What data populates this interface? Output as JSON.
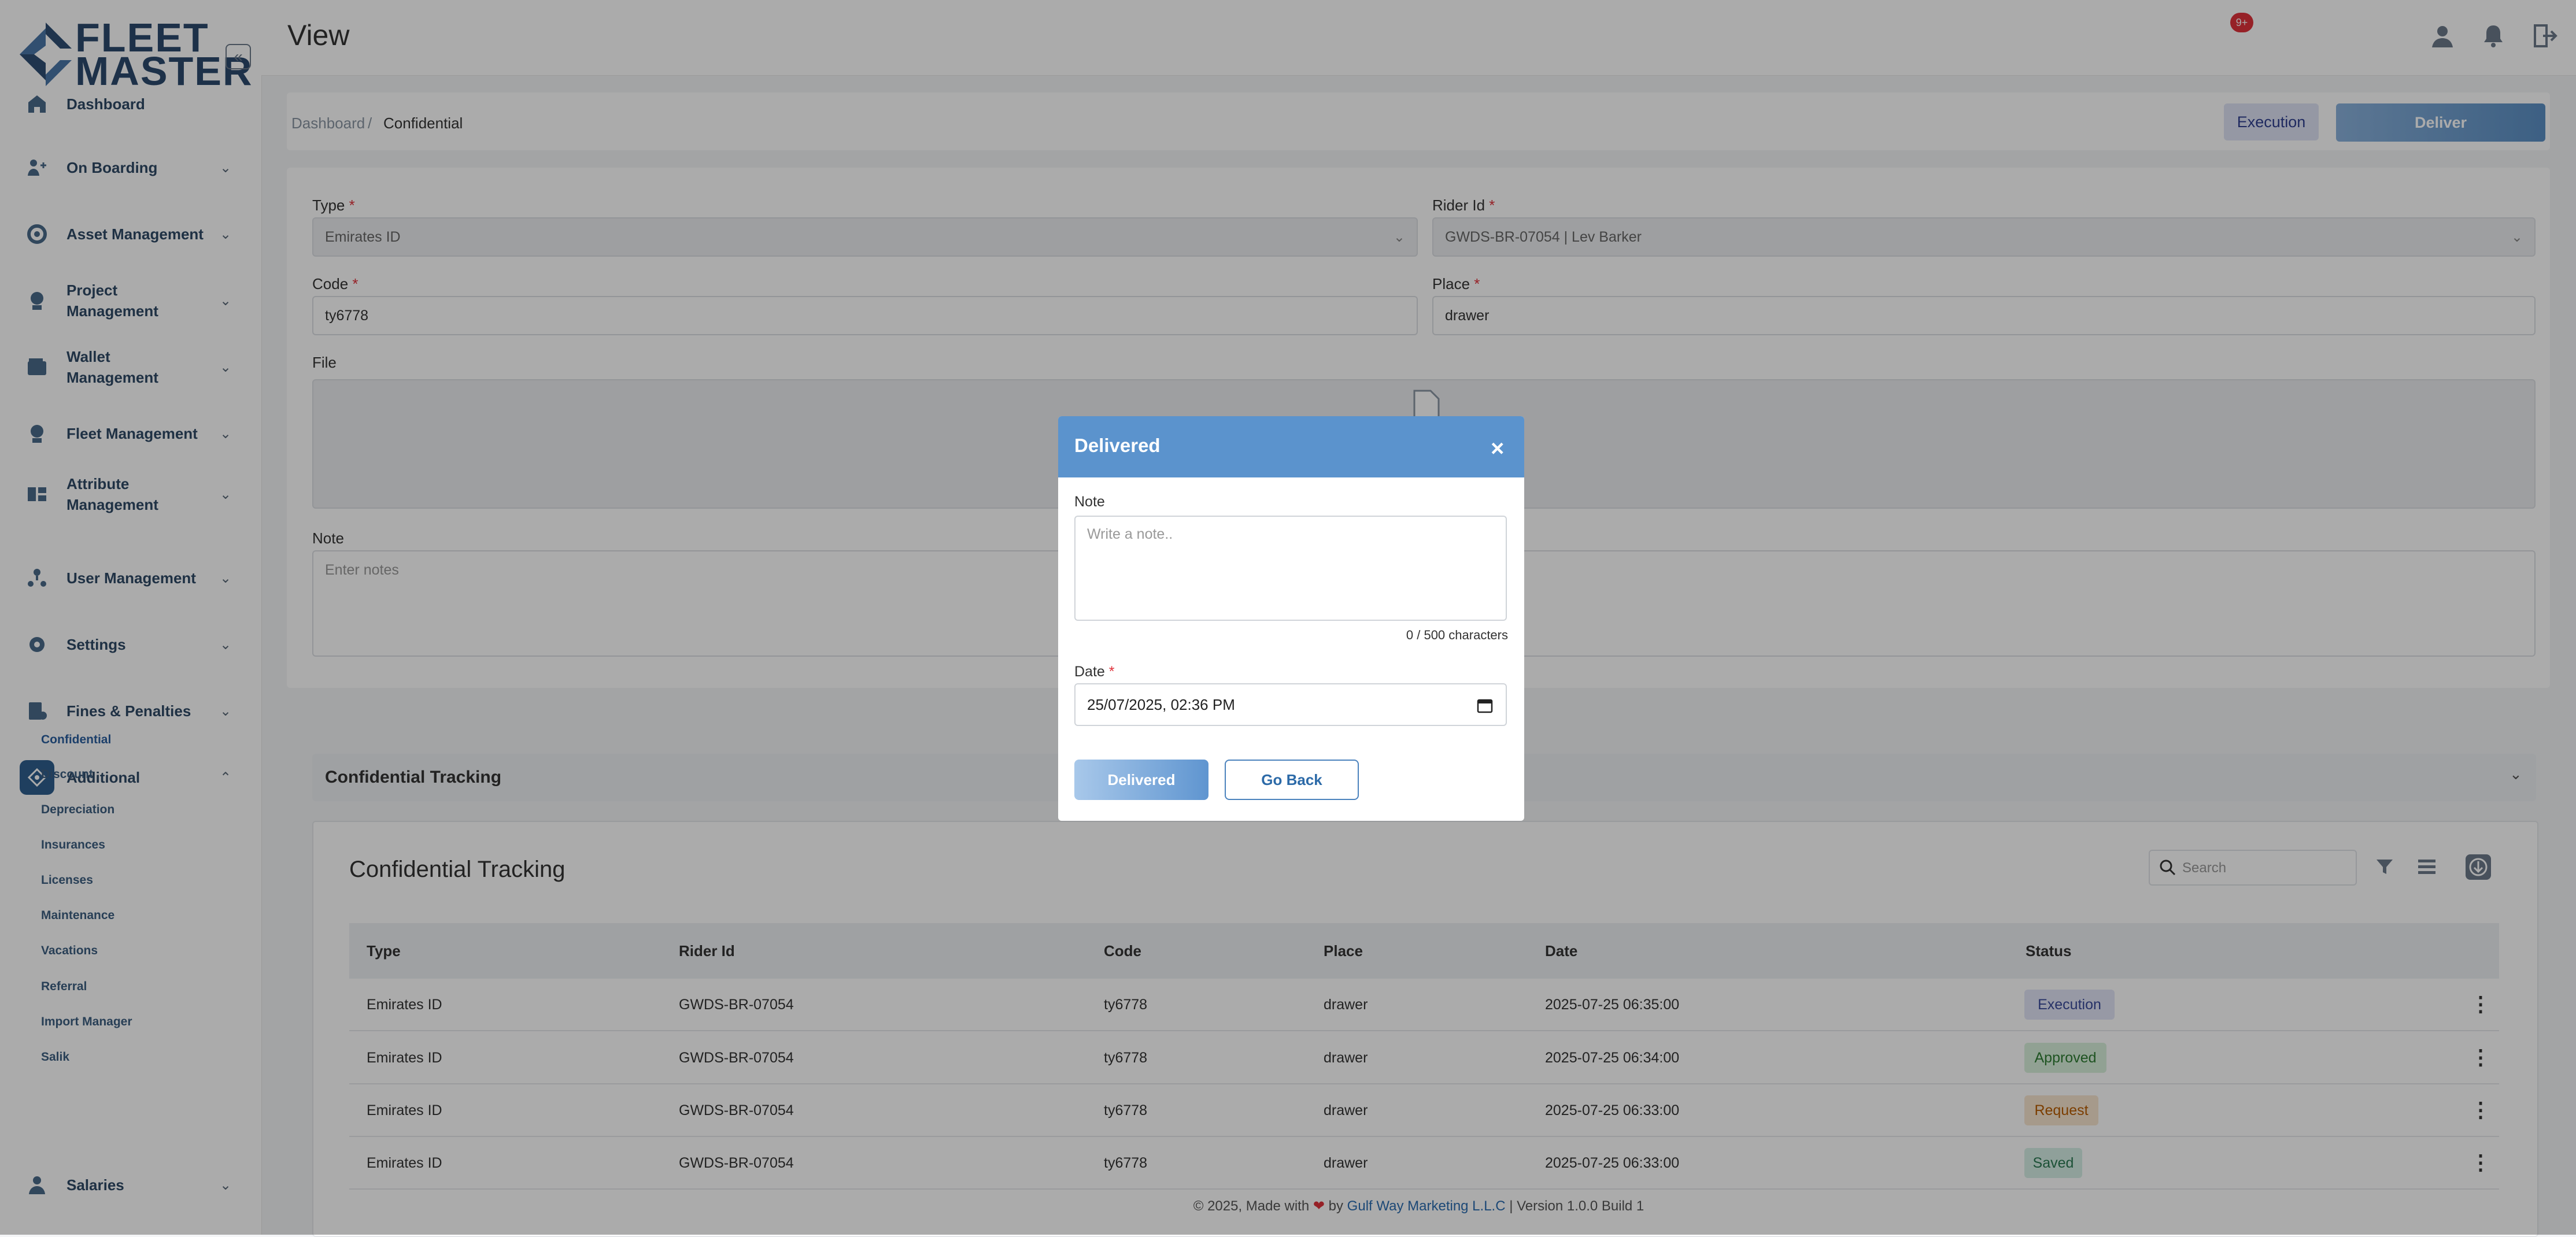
{
  "app": {
    "logo_line1": "FLEET",
    "logo_line2": "MASTER",
    "page_title": "View"
  },
  "sidebar": {
    "items": [
      {
        "label": "Dashboard",
        "icon": "home-icon"
      },
      {
        "label": "On Boarding",
        "icon": "onboarding-icon"
      },
      {
        "label": "Asset Management",
        "icon": "asset-icon"
      },
      {
        "label": "Project Management",
        "icon": "project-icon"
      },
      {
        "label": "Wallet Management",
        "icon": "wallet-icon"
      },
      {
        "label": "Fleet Management",
        "icon": "fleet-icon"
      },
      {
        "label": "Attribute Management",
        "icon": "attribute-icon"
      },
      {
        "label": "User Management",
        "icon": "users-icon"
      },
      {
        "label": "Settings",
        "icon": "gear-icon"
      },
      {
        "label": "Fines & Penalties",
        "icon": "fines-icon"
      },
      {
        "label": "Additional",
        "icon": "additional-icon"
      },
      {
        "label": "Salaries",
        "icon": "salaries-icon"
      }
    ],
    "subitems": [
      "Confidential",
      "Discount",
      "Depreciation",
      "Insurances",
      "Licenses",
      "Maintenance",
      "Vacations",
      "Referral",
      "Import Manager",
      "Salik"
    ]
  },
  "header": {
    "notification_badge": "9+"
  },
  "breadcrumb": {
    "home": "Dashboard",
    "sep": "/",
    "current": "Confidential"
  },
  "actions": {
    "execution": "Execution",
    "deliver": "Deliver"
  },
  "form": {
    "type_label": "Type",
    "type_value": "Emirates ID",
    "rider_label": "Rider Id",
    "rider_value": "GWDS-BR-07054 | Lev Barker",
    "code_label": "Code",
    "code_value": "ty6778",
    "place_label": "Place",
    "place_value": "drawer",
    "file_label": "File",
    "note_label": "Note",
    "note_placeholder": "Enter notes",
    "required_mark": "*"
  },
  "tracking": {
    "section_title": "Confidential Tracking",
    "card_title": "Confidential Tracking",
    "search_placeholder": "Search",
    "columns": [
      "Type",
      "Rider Id",
      "Code",
      "Place",
      "Date",
      "Status"
    ],
    "rows": [
      {
        "type": "Emirates ID",
        "rider": "GWDS-BR-07054",
        "code": "ty6778",
        "place": "drawer",
        "date": "2025-07-25 06:35:00",
        "status": "Execution"
      },
      {
        "type": "Emirates ID",
        "rider": "GWDS-BR-07054",
        "code": "ty6778",
        "place": "drawer",
        "date": "2025-07-25 06:34:00",
        "status": "Approved"
      },
      {
        "type": "Emirates ID",
        "rider": "GWDS-BR-07054",
        "code": "ty6778",
        "place": "drawer",
        "date": "2025-07-25 06:33:00",
        "status": "Request"
      },
      {
        "type": "Emirates ID",
        "rider": "GWDS-BR-07054",
        "code": "ty6778",
        "place": "drawer",
        "date": "2025-07-25 06:33:00",
        "status": "Saved"
      }
    ],
    "status_colors": {
      "Execution": {
        "bg": "#e1e4f6",
        "fg": "#3a4a9a"
      },
      "Approved": {
        "bg": "#d9f0dc",
        "fg": "#2e7d32"
      },
      "Request": {
        "bg": "#f8e6cf",
        "fg": "#b85c00"
      },
      "Saved": {
        "bg": "#d6efe6",
        "fg": "#2b7a52"
      }
    }
  },
  "footer": {
    "prefix": "© 2025, Made with",
    "heart": "❤",
    "by": "by",
    "company": "Gulf Way Marketing L.L.C",
    "version": "| Version 1.0.0 Build 1"
  },
  "modal": {
    "title": "Delivered",
    "close": "×",
    "note_label": "Note",
    "note_placeholder": "Write a note..",
    "char_count": "0 / 500 characters",
    "date_label": "Date",
    "date_value": "25/07/2025, 02:36 PM",
    "submit": "Delivered",
    "back": "Go Back"
  }
}
